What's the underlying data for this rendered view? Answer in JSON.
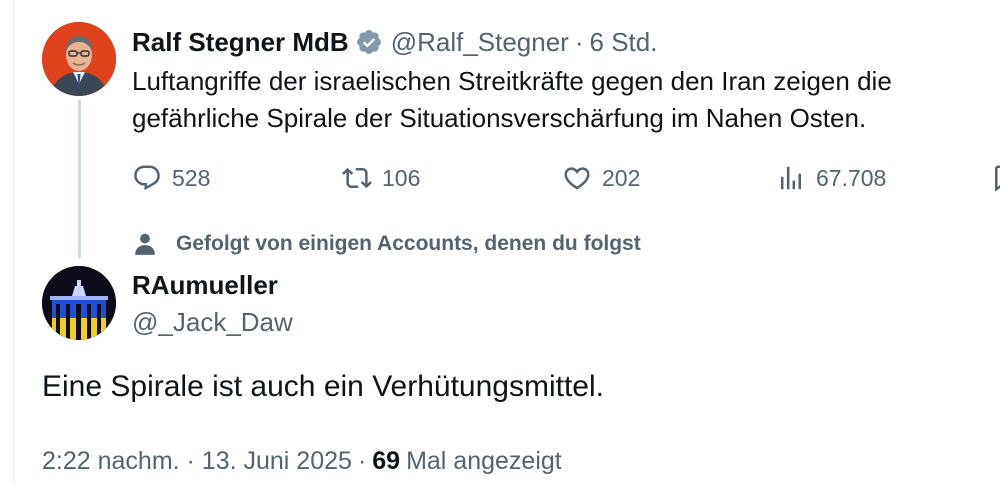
{
  "parent_tweet": {
    "author_name": "Ralf Stegner MdB",
    "handle": "@Ralf_Stegner",
    "separator": "·",
    "time": "6 Std.",
    "text": "Luftangriffe der israelischen Streitkräfte gegen den Iran zeigen die gefährliche Spirale der Situationsverschärfung im Nahen Osten.",
    "verified_icon": "verified-badge-icon",
    "stats": {
      "replies": "528",
      "reposts": "106",
      "likes": "202",
      "views": "67.708"
    }
  },
  "social_context": {
    "text": "Gefolgt von einigen Accounts, denen du folgst",
    "icon": "person-icon"
  },
  "reply_tweet": {
    "author_name": "RAumueller",
    "handle": "@_Jack_Daw",
    "text": "Eine Spirale ist auch ein Verhütungsmittel.",
    "timestamp": "2:22 nachm. · 13. Juni 2025",
    "separator": "·",
    "view_count": "69",
    "view_label": "Mal angezeigt"
  },
  "colors": {
    "text_primary": "#0f1419",
    "text_secondary": "#536471",
    "thread_line": "#cfd9de",
    "avatar1_bg": "#e0421c",
    "avatar2_blue": "#1e4fd6",
    "avatar2_yellow": "#f2cf1d"
  }
}
